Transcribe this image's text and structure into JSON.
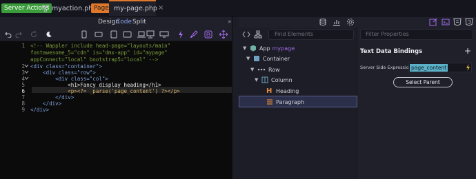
{
  "tabs": {
    "server_actions": "Server Actions",
    "myaction": "myaction.php",
    "pages": "Pages",
    "mypage": "my-page.php"
  },
  "view_tabs": {
    "design": "Design",
    "code": "Code",
    "split": "Split"
  },
  "editor": {
    "lines": [
      {
        "num": "1",
        "fold": "",
        "text": "<!-- Wappler include head-page=\"layouts/main\""
      },
      {
        "num": "",
        "fold": "",
        "text": "fontawesome_5=\"cdn\" is=\"dmx-app\" id=\"mypage\""
      },
      {
        "num": "",
        "fold": "",
        "text": "appConnect=\"local\" bootstrap5=\"local\" -->"
      },
      {
        "num": "2",
        "fold": "v",
        "text": "<div class=\"container\">"
      },
      {
        "num": "3",
        "fold": "v",
        "text": "    <div class=\"row\">"
      },
      {
        "num": "4",
        "fold": "v",
        "text": "        <div class=\"col\">"
      },
      {
        "num": "5",
        "fold": "",
        "text": "            <h1>Fancy display heading</h1>"
      },
      {
        "num": "6",
        "fold": "",
        "text": "            <p><?= _parse('page_content') ?></p>"
      },
      {
        "num": "7",
        "fold": "",
        "text": "        </div>"
      },
      {
        "num": "8",
        "fold": "",
        "text": "    </div>"
      },
      {
        "num": "9",
        "fold": "",
        "text": "</div>"
      }
    ]
  },
  "tree": {
    "search_placeholder": "Find Elements",
    "app_label": "App",
    "app_id": "mypage",
    "container": "Container",
    "row": "Row",
    "column": "Column",
    "heading": "Heading",
    "paragraph": "Paragraph"
  },
  "props": {
    "filter_placeholder": "Filter Properties",
    "section_title": "Text Data Bindings",
    "add_symbol": "+",
    "expr_label": "Server Side Expression",
    "expr_value": "page_content",
    "select_parent": "Select Parent"
  },
  "colors": {
    "accent": "#a56bf0",
    "server_badge": "#3b9c3b",
    "pages_badge": "#e0782c",
    "selection": "#2c2f4a",
    "binding_value_bg": "#5bb1c8",
    "lightning": "#f0c040"
  },
  "icons": [
    "undo-icon",
    "redo-icon",
    "refresh-icon",
    "moon-icon",
    "phone-icon",
    "phone-landscape-icon",
    "tablet-icon",
    "tablet-landscape-icon",
    "laptop-icon",
    "desktop-icon",
    "wide-screen-icon",
    "move-icon",
    "lightning-icon",
    "code-icon",
    "tree-icon",
    "database-icon",
    "settings-icon",
    "edit-icon",
    "terminal-icon",
    "css-icon",
    "html-icon"
  ]
}
